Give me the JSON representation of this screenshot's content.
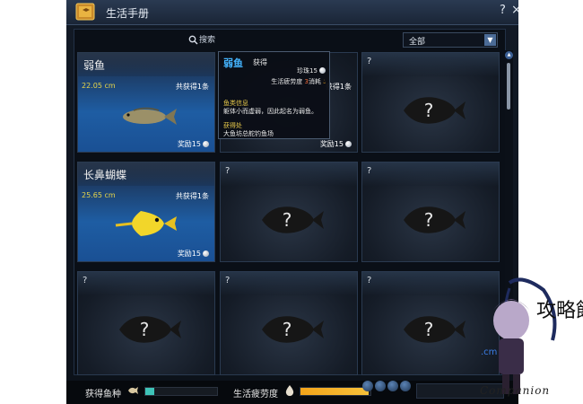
{
  "window": {
    "title": "生活手册",
    "help": "?",
    "close": "×"
  },
  "search": {
    "placeholder": "搜索",
    "filter_value": "全部"
  },
  "cards": [
    {
      "name": "弱鱼",
      "size": "22.05 cm",
      "count": "共获得1条",
      "reward": "奖励15",
      "found": true
    },
    {
      "name": "?",
      "found": false
    },
    {
      "name": "?",
      "found": false
    },
    {
      "name": "长鼻蝴蝶",
      "size": "25.65 cm",
      "count": "共获得1条",
      "reward": "奖励15",
      "found": true
    },
    {
      "name": "?",
      "found": false
    },
    {
      "name": "?",
      "found": false
    },
    {
      "name": "?",
      "found": false
    },
    {
      "name": "?",
      "found": false
    },
    {
      "name": "?",
      "found": false
    }
  ],
  "hidden_card": {
    "count": "获得1条",
    "reward": "奖励15"
  },
  "tooltip": {
    "name": "弱鱼",
    "state": "获得",
    "pearl": "珍珠15",
    "fatigue_label": "生活疲劳度",
    "fatigue_value": "3",
    "fatigue_suffix": "消耗",
    "info_heading": "鱼类信息",
    "info_text": "躯体小而虚弱，因此起名为弱鱼。",
    "source_heading": "获得处",
    "source_text": "大鱼坊总舵钓鱼场"
  },
  "footer": {
    "species_label": "获得鱼种",
    "species_progress": 0.12,
    "fatigue_label": "生活疲劳度",
    "fatigue_progress": 0.97
  },
  "watermark": {
    "text": "Companion",
    "logo_chars": "攻略館",
    "badge": ".cm"
  },
  "colors": {
    "accent_blue": "#44b4ff",
    "size_yellow": "#e6d54a",
    "fatigue_orange": "#f7c13a",
    "species_teal": "#3ec3b8"
  }
}
